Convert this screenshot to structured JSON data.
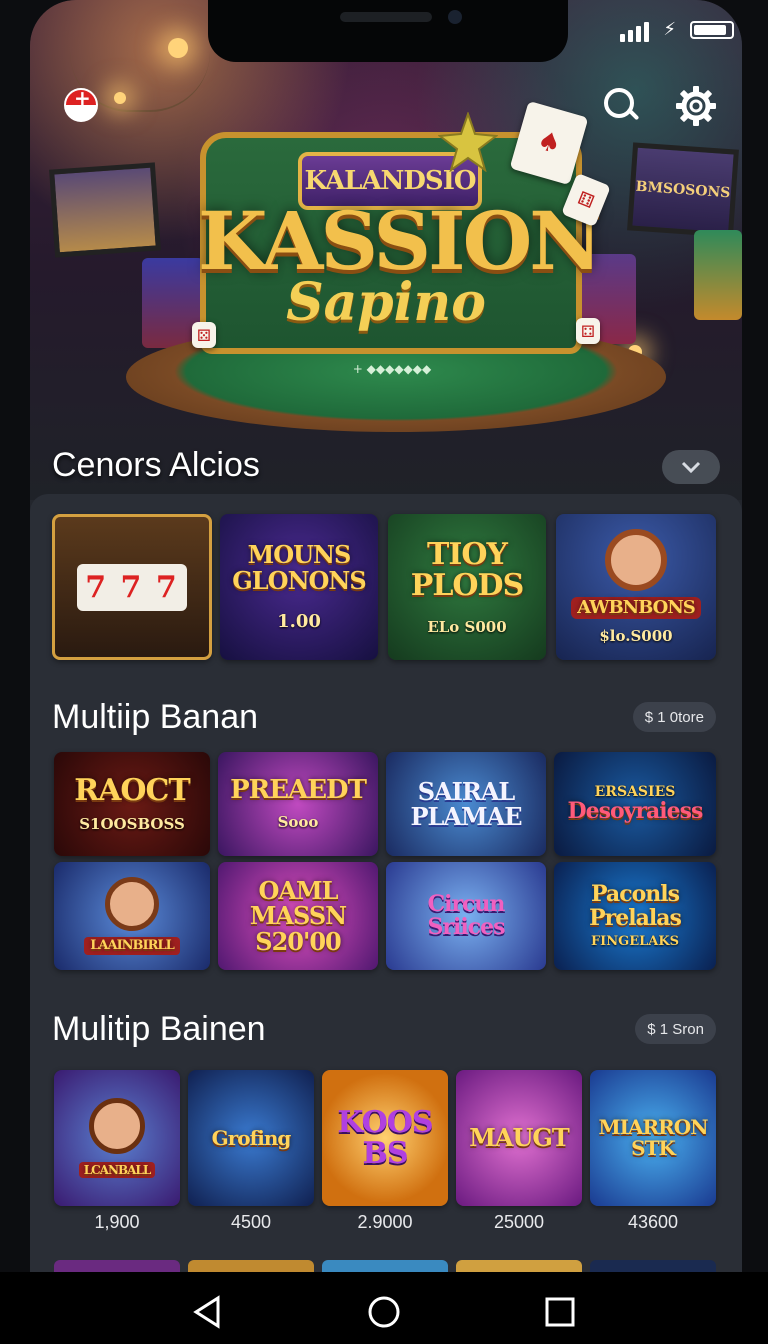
{
  "hero": {
    "sign_top": "KALANDSIO",
    "sign_main": "KASSION",
    "sign_script": "Sapino",
    "wall_screen_text": "BMSOSONS",
    "table_text": "+ ◆◆◆◆◆◆◆",
    "title": "Cenors Alcios"
  },
  "section1": {
    "tiles": [
      {
        "line1": "7 7 7",
        "line2": ""
      },
      {
        "line1": "MOUNS GLONONS",
        "line2": "1.00"
      },
      {
        "line1": "TIOY PLODS",
        "line2": "ELo S000"
      },
      {
        "line1": "AWBNBONS",
        "line2": "$lo.S000"
      }
    ]
  },
  "section2": {
    "title": "Multiip Banan",
    "pill": "$ 1 0tore",
    "tiles": [
      {
        "line1": "RAOCT",
        "line2": "S1OOSBOSS"
      },
      {
        "line1": "PREAEDT",
        "line2": "Sooo"
      },
      {
        "line1": "SAIRAL PLAMAE",
        "line2": ""
      },
      {
        "line1": "Desoyraiess",
        "line2": "ERSASIES"
      },
      {
        "line1": "LAAINBIRLL",
        "line2": ""
      },
      {
        "line1": "OAML MASSN S20'00",
        "line2": ""
      },
      {
        "line1": "Circun Sriices",
        "line2": ""
      },
      {
        "line1": "Paconls Prelalas",
        "line2": "FINGELAKS"
      }
    ]
  },
  "section3": {
    "title": "Mulitip Bainen",
    "pill": "$ 1 Sron",
    "tiles": [
      {
        "line1": "LCANBALL",
        "value": "1,900"
      },
      {
        "line1": "Grofing",
        "value": "4500"
      },
      {
        "line1": "KOOS BS",
        "value": "2.9000"
      },
      {
        "line1": "MAUGT",
        "value": "25000"
      },
      {
        "line1": "MIARRON STK",
        "value": "43600"
      }
    ]
  },
  "colors": {
    "accent_gold": "#ffd35a",
    "panel_bg": "#2a2e36",
    "pill_bg": "#3c414b"
  }
}
